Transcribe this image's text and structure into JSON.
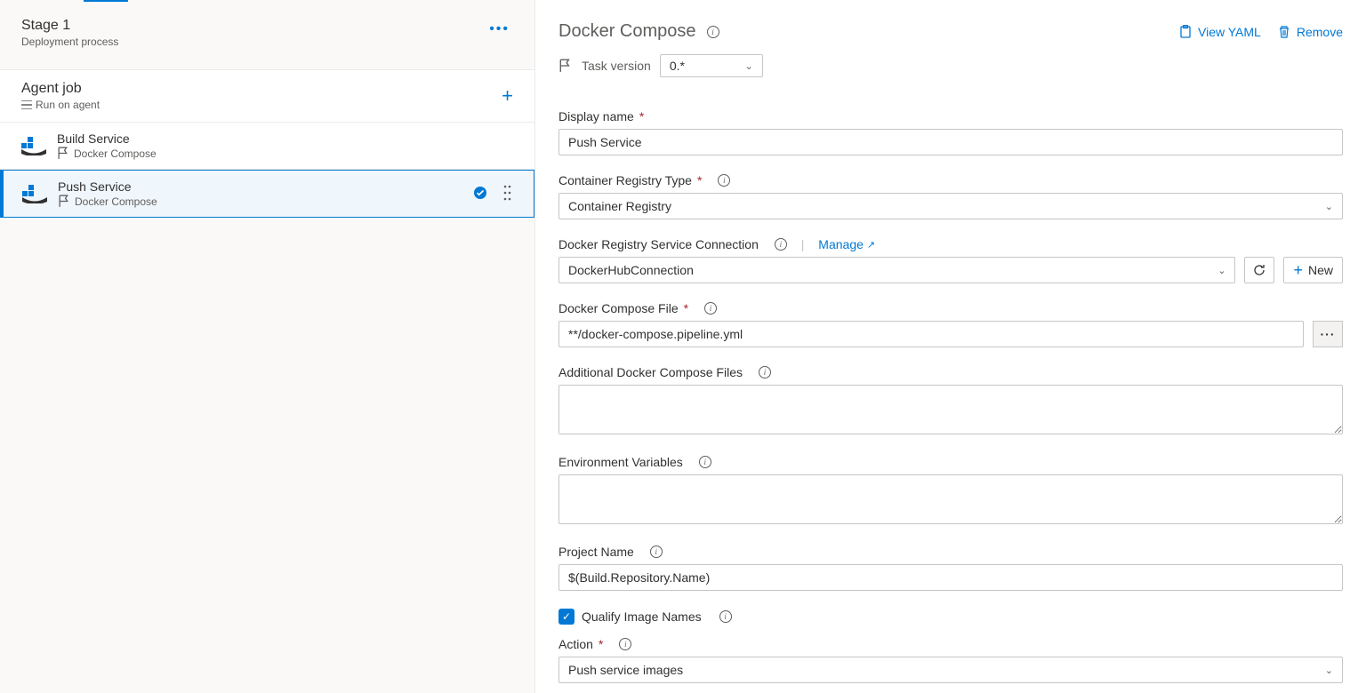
{
  "stage": {
    "title": "Stage 1",
    "subtitle": "Deployment process"
  },
  "job": {
    "title": "Agent job",
    "subtitle": "Run on agent"
  },
  "tasks": [
    {
      "name": "Build Service",
      "type": "Docker Compose",
      "selected": false
    },
    {
      "name": "Push Service",
      "type": "Docker Compose",
      "selected": true
    }
  ],
  "panel": {
    "title": "Docker Compose",
    "view_yaml": "View YAML",
    "remove": "Remove",
    "task_version_label": "Task version",
    "task_version_value": "0.*",
    "display_name_label": "Display name",
    "display_name_value": "Push Service",
    "registry_type_label": "Container Registry Type",
    "registry_type_value": "Container Registry",
    "conn_label": "Docker Registry Service Connection",
    "manage_label": "Manage",
    "conn_value": "DockerHubConnection",
    "new_label": "New",
    "compose_file_label": "Docker Compose File",
    "compose_file_value": "**/docker-compose.pipeline.yml",
    "additional_label": "Additional Docker Compose Files",
    "additional_value": "",
    "env_label": "Environment Variables",
    "env_value": "",
    "project_label": "Project Name",
    "project_value": "$(Build.Repository.Name)",
    "qualify_label": "Qualify Image Names",
    "qualify_checked": true,
    "action_label": "Action",
    "action_value": "Push service images"
  }
}
